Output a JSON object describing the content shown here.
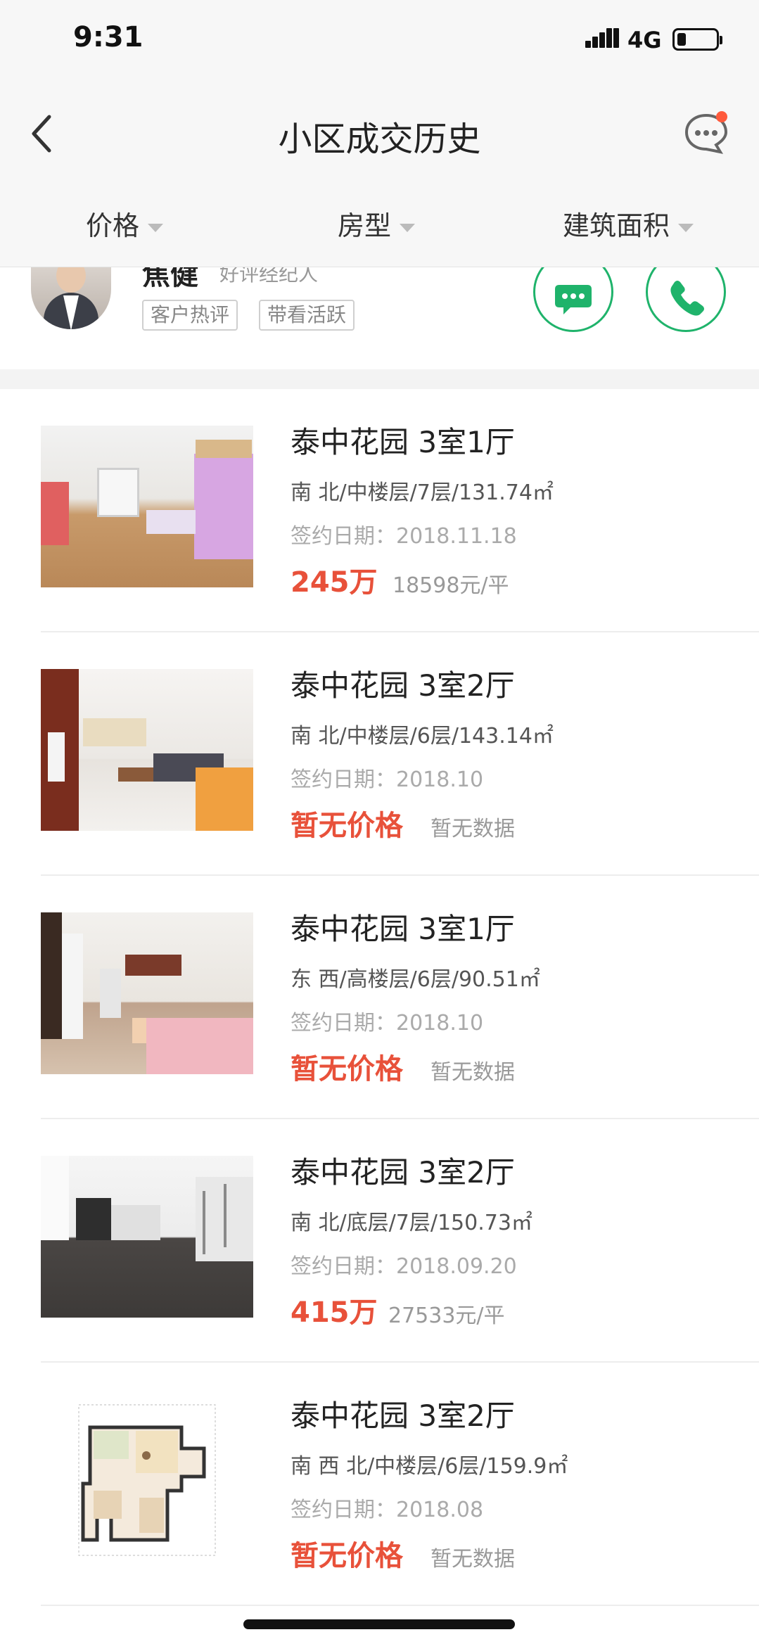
{
  "status_bar": {
    "time": "9:31",
    "network": "4G",
    "battery_icon": "battery-low-icon",
    "signal_icon": "signal-icon"
  },
  "nav": {
    "title": "小区成交历史",
    "back_icon": "chevron-left-icon",
    "message_icon": "chat-bubble-icon",
    "badge_color": "#ff5a3c"
  },
  "filters": [
    {
      "label": "价格"
    },
    {
      "label": "房型"
    },
    {
      "label": "建筑面积"
    }
  ],
  "agent": {
    "name": "焦健",
    "subtitle": "好评经纪人",
    "tags": [
      "客户热评",
      "带看活跃"
    ],
    "accent_color": "#1fb36b"
  },
  "listings": [
    {
      "title": "泰中花园 3室1厅",
      "info": "南 北/中楼层/7层/131.74㎡",
      "date": "签约日期：2018.11.18",
      "price": "245万",
      "unit_price": "18598元/平"
    },
    {
      "title": "泰中花园 3室2厅",
      "info": "南 北/中楼层/6层/143.14㎡",
      "date": "签约日期：2018.10",
      "price": "暂无价格",
      "unit_price": "暂无数据"
    },
    {
      "title": "泰中花园 3室1厅",
      "info": "东 西/高楼层/6层/90.51㎡",
      "date": "签约日期：2018.10",
      "price": "暂无价格",
      "unit_price": "暂无数据"
    },
    {
      "title": "泰中花园 3室2厅",
      "info": "南 北/底层/7层/150.73㎡",
      "date": "签约日期：2018.09.20",
      "price": "415万",
      "unit_price": "27533元/平"
    },
    {
      "title": "泰中花园 3室2厅",
      "info": "南 西 北/中楼层/6层/159.9㎡",
      "date": "签约日期：2018.08",
      "price": "暂无价格",
      "unit_price": "暂无数据"
    }
  ],
  "price_color": "#e8513a"
}
